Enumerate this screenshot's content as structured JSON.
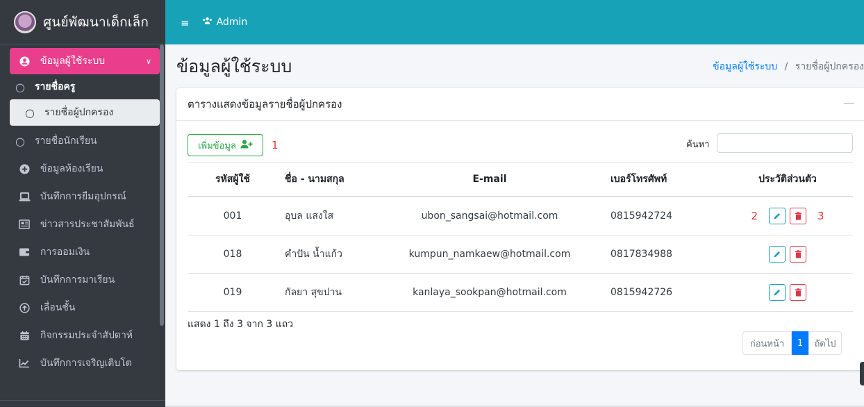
{
  "brand": {
    "title": "ศูนย์พัฒนาเด็กเล็ก"
  },
  "topbar": {
    "admin_label": "Admin"
  },
  "sidebar": {
    "items": [
      {
        "label": "ข้อมูลผู้ใช้ระบบ",
        "icon": "user-circle-icon"
      },
      {
        "label": "รายชื่อครู",
        "icon": "circle-icon"
      },
      {
        "label": "รายชื่อผู้ปกครอง",
        "icon": "circle-icon"
      },
      {
        "label": "รายชื่อนักเรียน",
        "icon": "circle-icon"
      },
      {
        "label": "ข้อมูลห้องเรียน",
        "icon": "plus-circle-icon"
      },
      {
        "label": "บันทึกการยืมอุปกรณ์",
        "icon": "laptop-icon"
      },
      {
        "label": "ข่าวสารประชาสัมพันธ์",
        "icon": "newspaper-icon"
      },
      {
        "label": "การออมเงิน",
        "icon": "wallet-icon"
      },
      {
        "label": "บันทึกการมาเรียน",
        "icon": "calendar-check-icon"
      },
      {
        "label": "เลื่อนชั้น",
        "icon": "arrow-up-circle-icon"
      },
      {
        "label": "กิจกรรมประจำสัปดาห์",
        "icon": "calendar-icon"
      },
      {
        "label": "บันทึกการเจริญเติบโต",
        "icon": "chart-line-icon"
      }
    ]
  },
  "page": {
    "title": "ข้อมูลผู้ใช้ระบบ"
  },
  "breadcrumb": {
    "parent": "ข้อมูลผู้ใช้ระบบ",
    "separator": "/",
    "current": "รายชื่อผู้ปกครอง"
  },
  "card": {
    "title": "ตารางแสดงข้อมูลรายชื่อผู้ปกครอง",
    "add_label": "เพิ่มข้อมูล",
    "search_label": "ค้นหา",
    "annotations": [
      "1",
      "2",
      "3"
    ]
  },
  "table": {
    "headers": [
      "รหัสผู้ใช้",
      "ชื่อ - นามสกุล",
      "E-mail",
      "เบอร์โทรศัพท์",
      "ประวัติส่วนตัว"
    ],
    "rows": [
      {
        "id": "001",
        "name": "อุบล แสงใส",
        "email": "ubon_sangsai@hotmail.com",
        "phone": "0815942724"
      },
      {
        "id": "018",
        "name": "คำปัน น้ำแก้ว",
        "email": "kumpun_namkaew@hotmail.com",
        "phone": "0817834988"
      },
      {
        "id": "019",
        "name": "กัลยา สุขปาน",
        "email": "kanlaya_sookpan@hotmail.com",
        "phone": "0815942726"
      }
    ]
  },
  "footer": {
    "info": "แสดง 1 ถึง 3 จาก 3 แถว"
  },
  "pagination": {
    "prev": "ก่อนหน้า",
    "page": "1",
    "next": "ถัดไป"
  }
}
